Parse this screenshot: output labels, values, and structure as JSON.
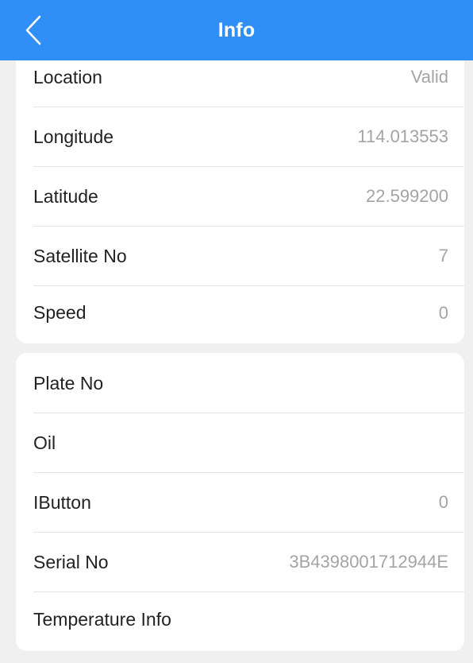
{
  "header": {
    "title": "Info",
    "back_icon": "chevron-left-icon"
  },
  "gps_section": {
    "rows": [
      {
        "label": "Location",
        "value": "Valid"
      },
      {
        "label": "Longitude",
        "value": "114.013553"
      },
      {
        "label": "Latitude",
        "value": "22.599200"
      },
      {
        "label": "Satellite No",
        "value": "7"
      },
      {
        "label": "Speed",
        "value": "0"
      }
    ]
  },
  "device_section": {
    "rows": [
      {
        "label": "Plate No",
        "value": ""
      },
      {
        "label": "Oil",
        "value": ""
      },
      {
        "label": "IButton",
        "value": "0"
      },
      {
        "label": "Serial No",
        "value": "3B4398001712944E"
      },
      {
        "label": "Temperature Info",
        "value": ""
      }
    ]
  },
  "colors": {
    "header_bg": "#2f8ff6",
    "page_bg": "#f0f0f0",
    "card_bg": "#ffffff",
    "label_text": "#222222",
    "value_text": "#a4a4a4"
  }
}
